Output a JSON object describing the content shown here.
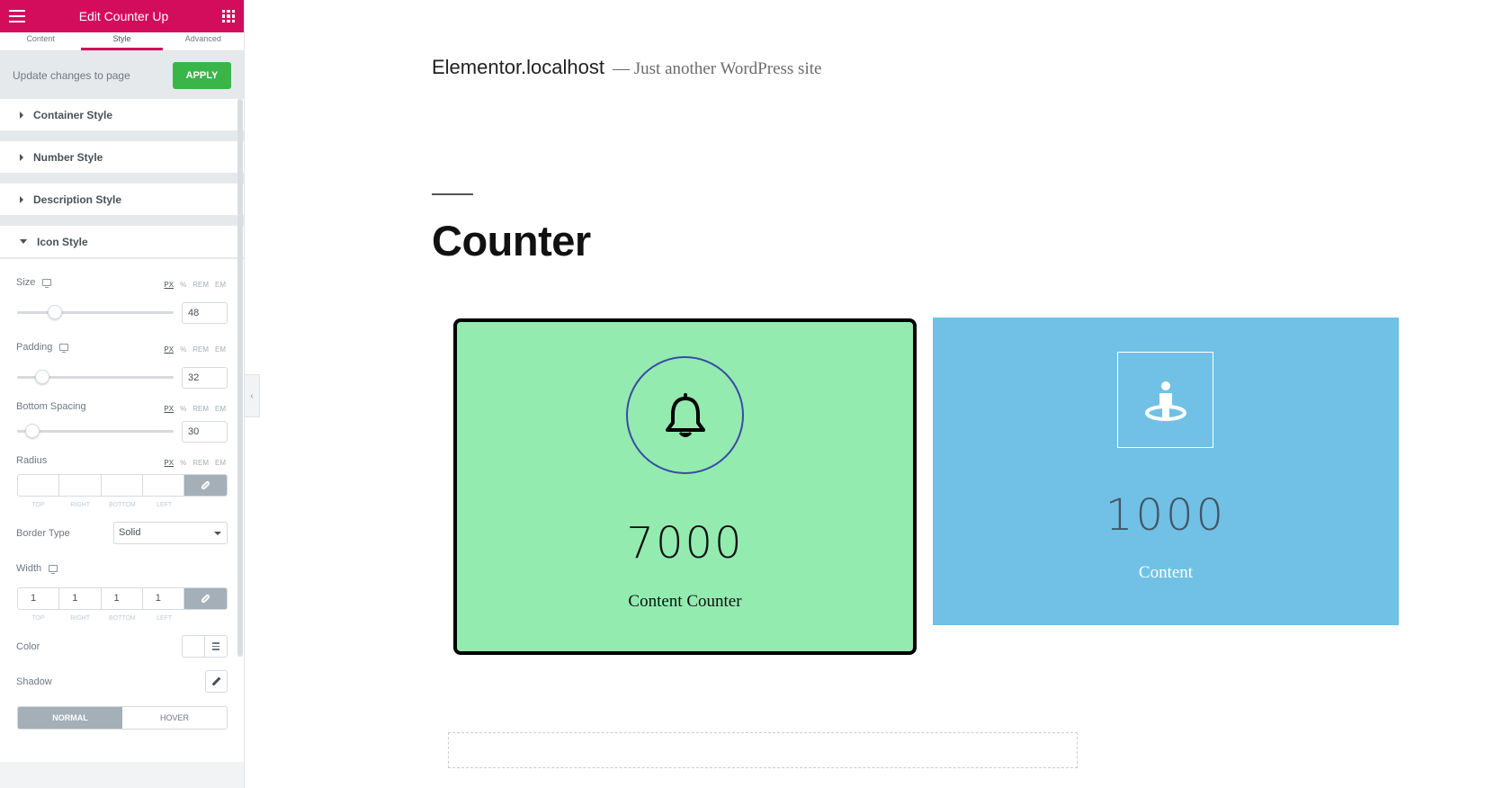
{
  "panel": {
    "title": "Edit Counter Up",
    "tabs": [
      "Content",
      "Style",
      "Advanced"
    ],
    "active_tab": "Style",
    "apply_message": "Update changes to page",
    "apply_label": "APPLY",
    "sections": {
      "container": "Container Style",
      "number": "Number Style",
      "description": "Description Style",
      "icon": "Icon Style"
    },
    "units": [
      "PX",
      "%",
      "REM",
      "EM"
    ],
    "size": {
      "label": "Size",
      "value": "48"
    },
    "padding": {
      "label": "Padding",
      "value": "32"
    },
    "bottom_spacing": {
      "label": "Bottom Spacing",
      "value": "30"
    },
    "radius": {
      "label": "Radius",
      "values": [
        "",
        "",
        "",
        ""
      ]
    },
    "dimension_labels": [
      "TOP",
      "RIGHT",
      "BOTTOM",
      "LEFT"
    ],
    "border_type": {
      "label": "Border Type",
      "value": "Solid"
    },
    "width": {
      "label": "Width",
      "values": [
        "1",
        "1",
        "1",
        "1"
      ]
    },
    "color": {
      "label": "Color"
    },
    "shadow": {
      "label": "Shadow"
    },
    "state_tabs": [
      "NORMAL",
      "HOVER"
    ]
  },
  "site": {
    "title": "Elementor.localhost",
    "tagline": "— Just another WordPress site",
    "heading": "Counter"
  },
  "counters": [
    {
      "number": "7000",
      "description": "Content Counter",
      "icon": "bell-icon",
      "background": "#93ebb0"
    },
    {
      "number": "1000",
      "description": "Content",
      "icon": "person-pin-icon",
      "background": "#70c1e5"
    }
  ],
  "colors": {
    "accent": "#d30c5c",
    "apply": "#39b54a"
  }
}
